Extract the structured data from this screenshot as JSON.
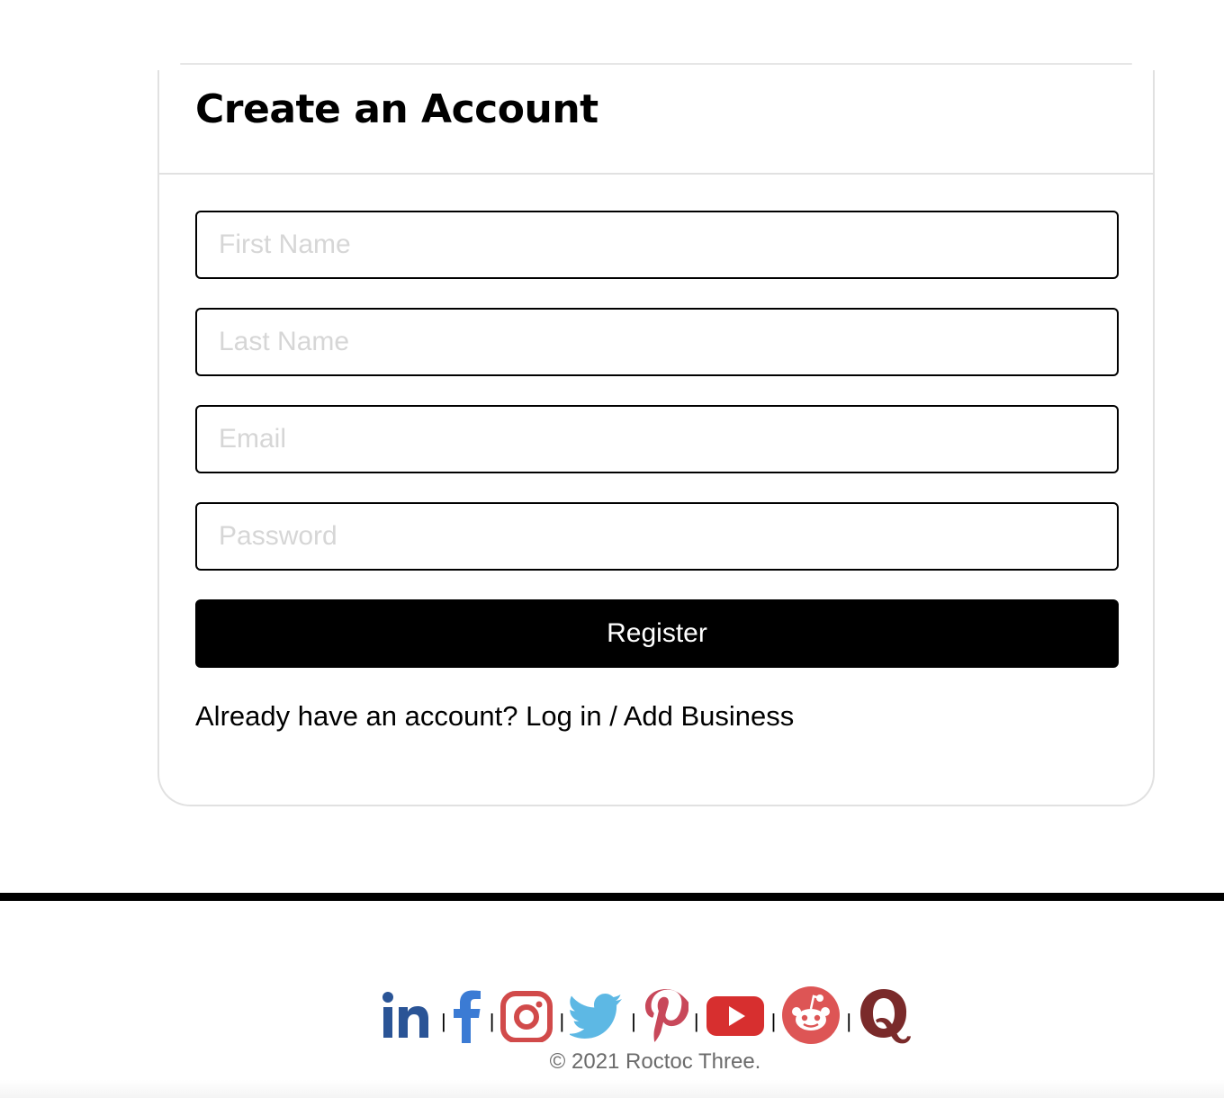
{
  "form": {
    "title": "Create an Account",
    "fields": [
      {
        "placeholder": "First Name",
        "value": ""
      },
      {
        "placeholder": "Last Name",
        "value": ""
      },
      {
        "placeholder": "Email",
        "value": ""
      },
      {
        "placeholder": "Password",
        "value": ""
      }
    ],
    "register_label": "Register",
    "login_prompt": "Already have an account?",
    "login_link": "Log in",
    "separator": "/",
    "add_business_link": "Add Business"
  },
  "footer": {
    "social_icons": [
      "linkedin-icon",
      "facebook-icon",
      "instagram-icon",
      "twitter-icon",
      "pinterest-icon",
      "youtube-icon",
      "reddit-icon",
      "quora-icon"
    ],
    "separator": "|",
    "copyright": "© 2021 Roctoc Three."
  },
  "colors": {
    "linkedin": "#2a5496",
    "facebook": "#3b7bd4",
    "instagram": "#d14a4a",
    "twitter": "#5db8e4",
    "pinterest": "#c8485a",
    "youtube": "#d72f2f",
    "reddit": "#dd5555",
    "quora": "#7a2a2a"
  }
}
